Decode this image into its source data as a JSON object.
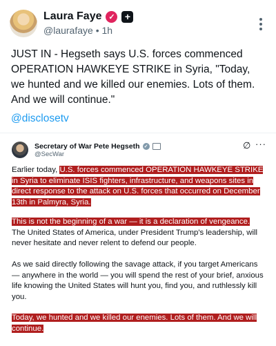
{
  "post": {
    "display_name": "Laura Faye",
    "handle": "@laurafaye",
    "separator": "•",
    "time": "1h",
    "text": "JUST IN - Hegseth says U.S. forces commenced OPERATION HAWKEYE STRIKE in Syria, \"Today, we hunted and we killed our enemies. Lots of them. And we will continue.\"",
    "mention": "@disclosetv"
  },
  "quoted": {
    "name": "Secretary of War Pete Hegseth",
    "handle": "@SecWar",
    "more_label": "···",
    "p1_lead": "Earlier today, ",
    "p1_highlight": "U.S. forces commenced OPERATION HAWKEYE STRIKE in Syria to eliminate ISIS fighters, infrastructure, and weapons sites in direct response to the attack on U.S. forces that occurred on December 13th in Palmyra, Syria.",
    "p2_highlight": "This is not the beginning of a war — it is a declaration of vengeance.",
    "p2_rest": " The United States of America, under President Trump's leadership, will never hesitate and never relent to defend our people.",
    "p3": "As we said directly following the savage attack, if you target Americans — anywhere in the world — you will spend the rest of your brief, anxious life knowing the United States will hunt you, find you, and ruthlessly kill you.",
    "p4_highlight": "Today, we hunted and we killed our enemies. Lots of them. And we will continue."
  },
  "colors": {
    "highlight": "#b01e1e",
    "link": "#1d9bf0",
    "badge": "#e0245e"
  },
  "icons": [
    "verified-icon",
    "plus-icon",
    "more-vertical-icon",
    "grok-icon",
    "more-horizontal-icon",
    "flag-icon"
  ]
}
